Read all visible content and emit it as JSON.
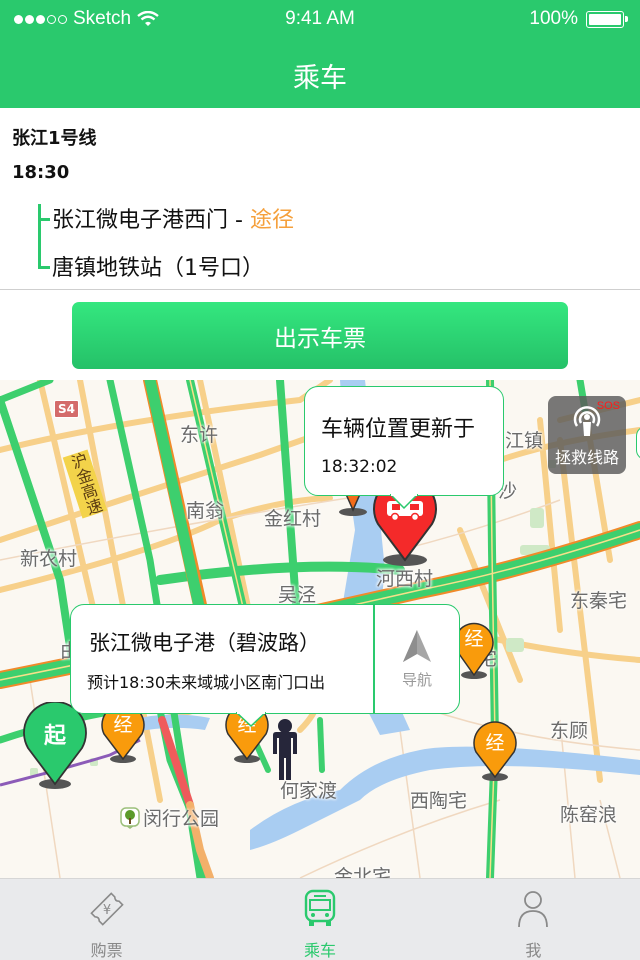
{
  "status_bar": {
    "carrier": "Sketch",
    "signal_filled": 3,
    "signal_total": 5,
    "time": "9:41 AM",
    "battery": "100%"
  },
  "nav": {
    "title": "乘车"
  },
  "trip": {
    "line_name": "张江1号线",
    "depart_time": "18:30",
    "stops": [
      {
        "name": "张江微电子港西门",
        "separator": " - ",
        "via_label": "途径"
      },
      {
        "name": "唐镇地铁站（1号口）"
      }
    ]
  },
  "actions": {
    "show_ticket": "出示车票"
  },
  "map": {
    "labels": {
      "dongxu": "东许",
      "nanweng": "南翁",
      "jinhongcun": "金红村",
      "xinnongcun": "新农村",
      "wujing": "吴泾",
      "hexicun": "河西村",
      "jiangzhen": "江镇",
      "dongqinzhai": "东秦宅",
      "donggu": "东顾",
      "hejiadu": "何家渡",
      "xitaozhai": "西陶宅",
      "chenyaolang": "陈窑浪",
      "minhang_park": "闵行公园",
      "jinbeizhai": "金北宅",
      "sha": "沙",
      "hu_partial": "由",
      "zhai_partial": "宅"
    },
    "highway_label": "沪金高速",
    "highway_shield": "S4",
    "vehicle_bubble": {
      "title": "车辆位置更新于",
      "time": "18:32:02"
    },
    "stop_bubble": {
      "title": "张江微电子港（碧波路）",
      "subtitle": "预计18:30未来域城小区南门口出",
      "nav_label": "导航"
    },
    "sos": {
      "badge": "SOS",
      "label": "拯救线路"
    },
    "pins": {
      "start": "起",
      "waypoint": "经"
    },
    "colors": {
      "start_pin": "#2ac96d",
      "waypoint_pin": "#f99b0c",
      "bus_pin": "#f42a2a",
      "road_green": "#3dcf6e",
      "road_yellow": "#f7d08a",
      "water": "#a9cdf2"
    }
  },
  "tabbar": {
    "tabs": [
      {
        "label": "购票",
        "icon": "ticket-icon",
        "active": false
      },
      {
        "label": "乘车",
        "icon": "bus-icon",
        "active": true
      },
      {
        "label": "我",
        "icon": "person-icon",
        "active": false
      }
    ]
  },
  "theme": {
    "accent": "#2ac96d",
    "via_color": "#f5a03c"
  }
}
